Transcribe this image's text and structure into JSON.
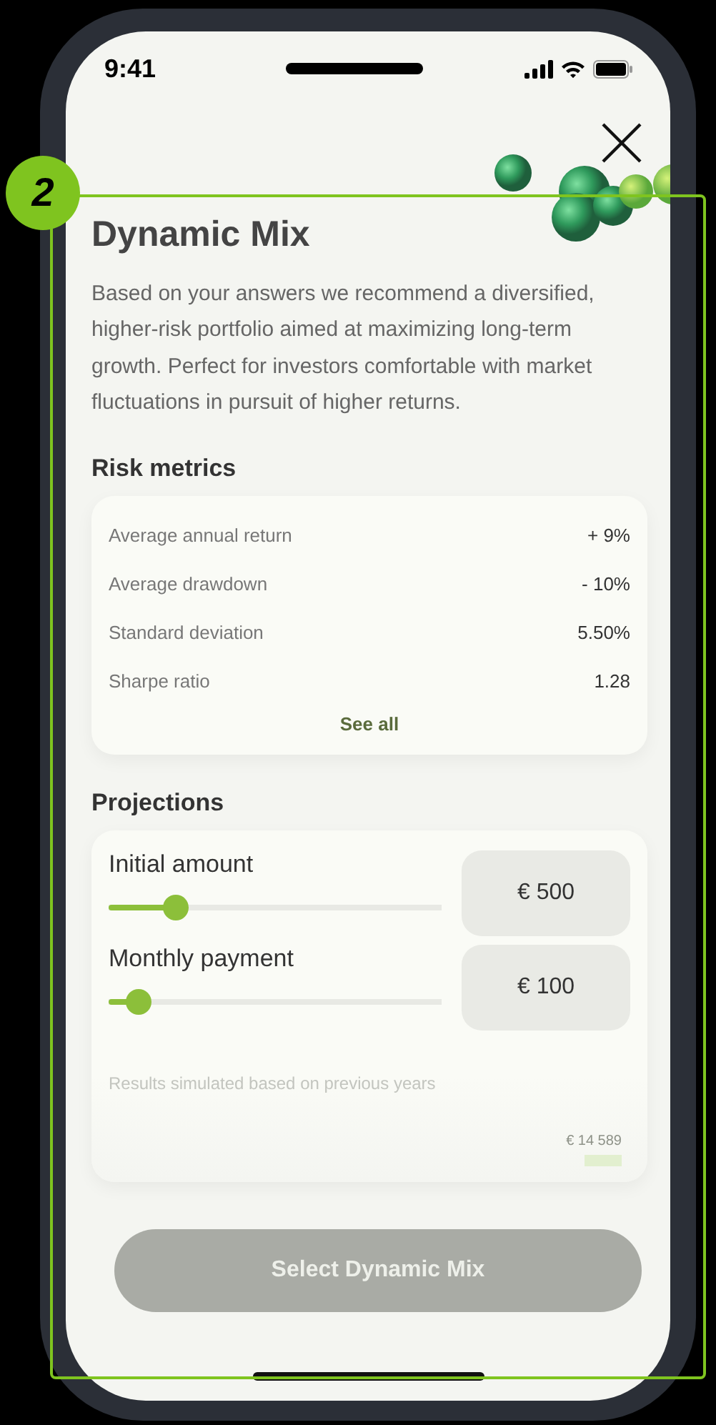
{
  "status_bar": {
    "time": "9:41"
  },
  "step_badge": {
    "label": "2"
  },
  "title": "Dynamic Mix",
  "description": "Based on your answers we recommend a diversified, higher-risk portfolio aimed at maximizing long-term growth. Perfect for investors comfortable with market fluctuations in pursuit of higher returns.",
  "risk_metrics": {
    "heading": "Risk metrics",
    "rows": [
      {
        "label": "Average annual return",
        "value": "+ 9%"
      },
      {
        "label": "Average drawdown",
        "value": "- 10%"
      },
      {
        "label": "Standard deviation",
        "value": "5.50%"
      },
      {
        "label": "Sharpe ratio",
        "value": "1.28"
      }
    ],
    "link": "See all"
  },
  "projections": {
    "heading": "Projections",
    "inputs": [
      {
        "label": "Initial amount",
        "level": 0.2,
        "value": "€ 500"
      },
      {
        "label": "Monthly payment",
        "level": 0.09,
        "value": "€ 100"
      }
    ],
    "note": "Results simulated based on previous years",
    "result": "€ 14 589"
  },
  "primary_button": {
    "label": "Select Dynamic Mix",
    "disabled": true
  }
}
